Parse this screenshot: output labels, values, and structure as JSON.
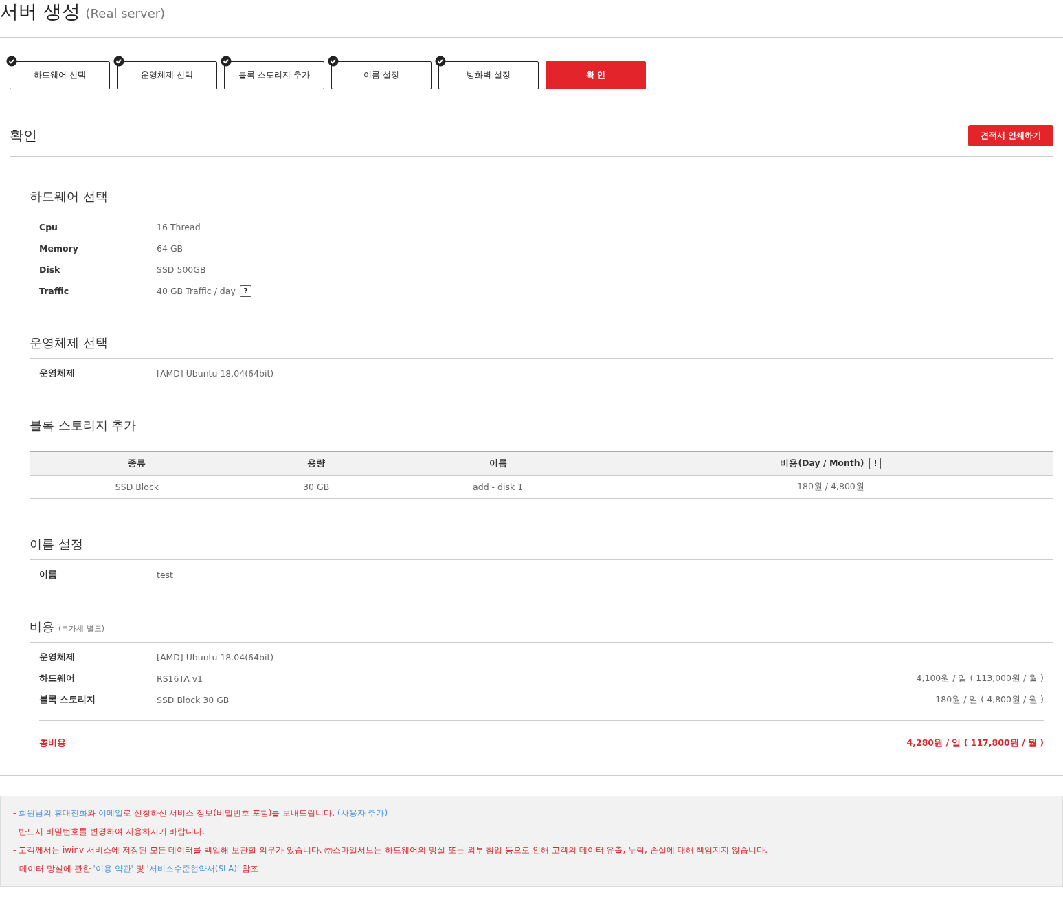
{
  "page_title": {
    "title": "서버 생성",
    "subtitle": "(Real server)"
  },
  "steps": [
    {
      "label": "하드웨어 선택",
      "done": true,
      "selected": false
    },
    {
      "label": "운영체제 선택",
      "done": true,
      "selected": false
    },
    {
      "label": "블록 스토리지 추가",
      "done": true,
      "selected": false
    },
    {
      "label": "이름 설정",
      "done": true,
      "selected": false
    },
    {
      "label": "방화벽 설정",
      "done": true,
      "selected": false
    },
    {
      "label": "확 인",
      "done": false,
      "selected": true
    }
  ],
  "confirm": {
    "title": "확인",
    "print_button": "견적서 인쇄하기"
  },
  "hardware": {
    "title": "하드웨어 선택",
    "rows": [
      {
        "label": "Cpu",
        "value": "16 Thread"
      },
      {
        "label": "Memory",
        "value": "64 GB"
      },
      {
        "label": "Disk",
        "value": "SSD 500GB"
      },
      {
        "label": "Traffic",
        "value": "40 GB Traffic / day",
        "help_icon": "?"
      }
    ]
  },
  "os": {
    "title": "운영체제 선택",
    "rows": [
      {
        "label": "운영체제",
        "value": "[AMD] Ubuntu 18.04(64bit)"
      }
    ]
  },
  "storage": {
    "title": "블록 스토리지 추가",
    "columns": [
      "종류",
      "용량",
      "이름",
      "비용(Day / Month)"
    ],
    "info_icon": "!",
    "rows": [
      [
        "SSD Block",
        "30 GB",
        "add - disk 1",
        "180원 / 4,800원"
      ]
    ]
  },
  "name": {
    "title": "이름 설정",
    "rows": [
      {
        "label": "이름",
        "value": "test"
      }
    ]
  },
  "cost": {
    "title": "비용",
    "note": "(부가세 별도)",
    "rows": [
      {
        "label": "운영체제",
        "value": "[AMD] Ubuntu 18.04(64bit)"
      },
      {
        "label": "하드웨어",
        "value": "RS16TA v1",
        "price": "4,100원 / 일 ( 113,000원 / 월 )"
      },
      {
        "label": "블록 스토리지",
        "value": "SSD Block 30 GB",
        "price": "180원 / 일 ( 4,800원 / 월 )"
      }
    ],
    "total_label": "총비용",
    "total": "4,280원 / 일 ( 117,800원 / 월 )"
  },
  "notice": [
    [
      {
        "kind": "text",
        "text": "- "
      },
      {
        "kind": "link",
        "text": "회원님의 휴대전화"
      },
      {
        "kind": "text",
        "text": "와 "
      },
      {
        "kind": "link",
        "text": "이메일"
      },
      {
        "kind": "text",
        "text": "로 신청하신 서비스 정보(비밀번호 포함)를 보내드립니다. "
      },
      {
        "kind": "link",
        "text": "(사용자 추가)"
      }
    ],
    [
      {
        "kind": "text",
        "text": "- 반드시 비밀번호를 변경하여 사용하시기 바랍니다."
      }
    ],
    [
      {
        "kind": "text",
        "text": "- 고객께서는 iwinv 서비스에 저장된 모든 데이터를 백업해 보관할 의무가 있습니다. ㈜스마일서브는 하드웨어의 망실 또는 외부 침입 등으로 인해 고객의 데이터 유출, 누락, 손실에 대해 책임지지 않습니다."
      }
    ],
    [
      {
        "kind": "text",
        "text": "데이터 망실에 관한 "
      },
      {
        "kind": "link",
        "text": "'이용 약관'"
      },
      {
        "kind": "text",
        "text": " 및 "
      },
      {
        "kind": "link",
        "text": "'서비스수준협약서(SLA)'"
      },
      {
        "kind": "text",
        "text": " 참조"
      }
    ]
  ]
}
